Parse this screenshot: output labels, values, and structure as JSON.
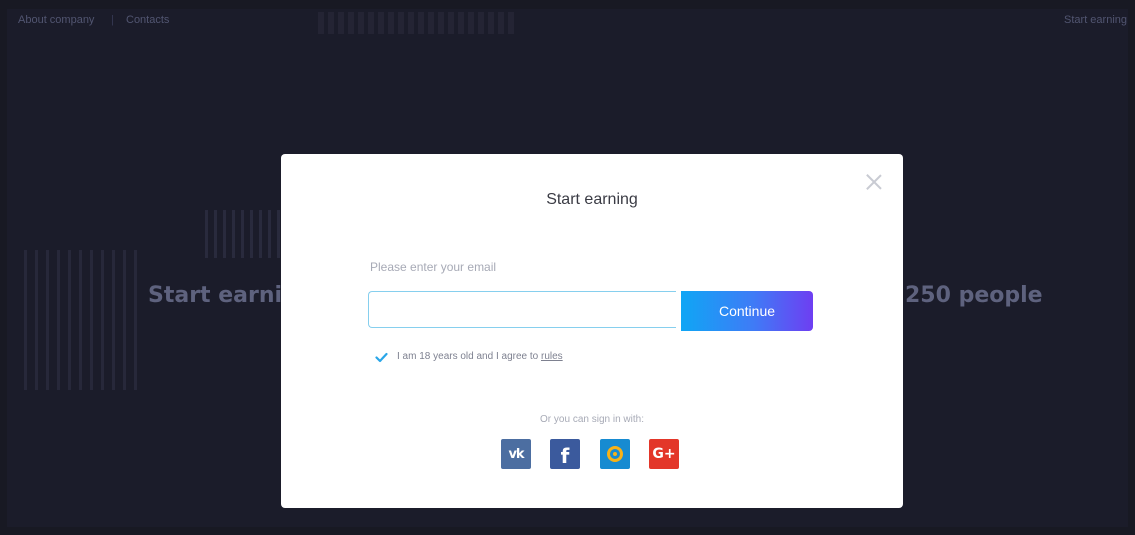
{
  "nav": {
    "about": "About company",
    "contacts": "Contacts",
    "start": "Start earning"
  },
  "hero": {
    "left": "Start earnin",
    "right": "250 people"
  },
  "modal": {
    "title": "Start earning",
    "email_label": "Please enter your email",
    "email_value": "",
    "continue_label": "Continue",
    "agree_text": "I am 18 years old and I agree to ",
    "rules_link": "rules",
    "agree_checked": true,
    "or_text": "Or you can sign in with:"
  },
  "socials": [
    {
      "name": "vk-icon",
      "label": "vk"
    },
    {
      "name": "facebook-icon",
      "label": "f"
    },
    {
      "name": "mail-icon",
      "label": "@"
    },
    {
      "name": "google-plus-icon",
      "label": "G+"
    }
  ],
  "colors": {
    "background": "#1f2030",
    "accent_start": "#0fa6f5",
    "accent_end": "#6e3ef2",
    "input_border": "#86cfee",
    "check": "#2aa6e8",
    "vk": "#4c6ea1",
    "facebook": "#3b5a9d",
    "mail": "#178bd1",
    "mail_ring": "#f7b218",
    "google_plus": "#e33629"
  }
}
